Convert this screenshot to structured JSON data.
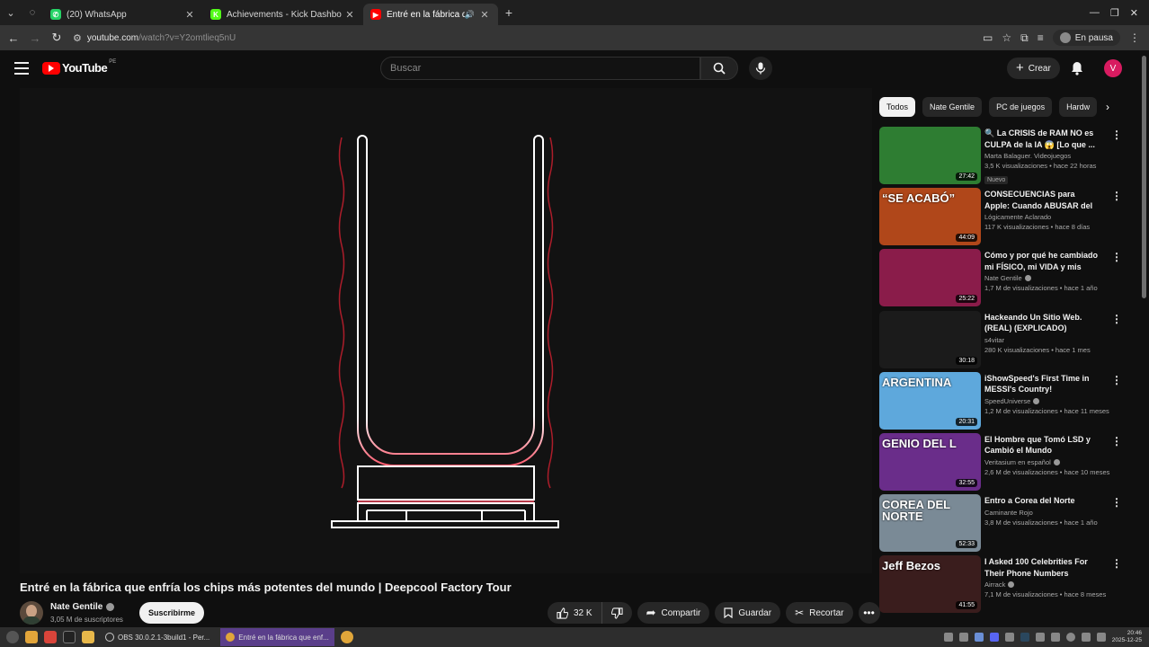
{
  "browser": {
    "tabs": [
      {
        "title": "(20) WhatsApp",
        "fav_color": "#25d366",
        "fav_glyph": "✆"
      },
      {
        "title": "Achievements - Kick Dashbo",
        "fav_color": "#53fc18",
        "fav_glyph": "K"
      },
      {
        "title": "Entré en la fábrica que e",
        "fav_color": "#ff0000",
        "fav_glyph": "▶"
      }
    ],
    "url_site": "youtube.com",
    "url_rest": "/watch?v=Y2omtlieq5nU",
    "profile_status": "En pausa"
  },
  "youtube": {
    "logo_text": "YouTube",
    "logo_country": "PE",
    "search_placeholder": "Buscar",
    "create_label": "Crear",
    "avatar_letter": "V"
  },
  "video": {
    "title": "Entré en la fábrica que enfría los chips más potentes del mundo | Deepcool Factory Tour",
    "channel": "Nate Gentile",
    "subscribers": "3,05 M de suscriptores",
    "subscribe_label": "Suscribirme",
    "likes": "32 K",
    "share_label": "Compartir",
    "save_label": "Guardar",
    "clip_label": "Recortar"
  },
  "chips": [
    "Todos",
    "Nate Gentile",
    "PC de juegos",
    "Hardw"
  ],
  "recommendations": [
    {
      "title": "🔍 La CRISIS de RAM NO es CULPA de la IA 😱 [Lo que ...",
      "channel": "Marta Balaguer. Videojuegos",
      "verified": false,
      "meta": "3,5 K visualizaciones • hace 22 horas",
      "badge": "Nuevo",
      "duration": "27:42",
      "thumb_text": "",
      "thumb_bg": "#2e7d32"
    },
    {
      "title": "CONSECUENCIAS para Apple: Cuando ABUSAR del Usuario ...",
      "channel": "Lógicamente Aclarado",
      "verified": false,
      "meta": "117 K visualizaciones • hace 8 días",
      "badge": "",
      "duration": "44:09",
      "thumb_text": "“SE ACABÓ”",
      "thumb_bg": "#b0471a"
    },
    {
      "title": "Cómo y por qué he cambiado mi FÍSICO, mi VIDA y mis HÁBITOS",
      "channel": "Nate Gentile",
      "verified": true,
      "meta": "1,7 M de visualizaciones • hace 1 año",
      "badge": "",
      "duration": "25:22",
      "thumb_text": "",
      "thumb_bg": "#8a1c4a"
    },
    {
      "title": "Hackeando Un Sitio Web. (REAL) (EXPLICADO)",
      "channel": "s4vitar",
      "verified": false,
      "meta": "280 K visualizaciones • hace 1 mes",
      "badge": "",
      "duration": "30:18",
      "thumb_text": "",
      "thumb_bg": "#1b1b1b"
    },
    {
      "title": "iShowSpeed's First Time in MESSI's Country!",
      "channel": "SpeedUniverse",
      "verified": true,
      "meta": "1,2 M de visualizaciones • hace 11 meses",
      "badge": "",
      "duration": "20:31",
      "thumb_text": "ARGENTINA",
      "thumb_bg": "#5ea8dc"
    },
    {
      "title": "El Hombre que Tomó LSD y Cambió el Mundo",
      "channel": "Veritasium en español",
      "verified": true,
      "meta": "2,6 M de visualizaciones • hace 10 meses",
      "badge": "",
      "duration": "32:55",
      "thumb_text": "GENIO DEL L",
      "thumb_bg": "#6a2d8a"
    },
    {
      "title": "Entro a Corea del Norte",
      "channel": "Caminante Rojo",
      "verified": false,
      "meta": "3,8 M de visualizaciones • hace 1 año",
      "badge": "",
      "duration": "52:33",
      "thumb_text": "COREA DEL NORTE",
      "thumb_bg": "#7a8a96"
    },
    {
      "title": "I Asked 100 Celebrities For Their Phone Numbers",
      "channel": "Airrack",
      "verified": true,
      "meta": "7,1 M de visualizaciones • hace 8 meses",
      "badge": "",
      "duration": "41:55",
      "thumb_text": "Jeff Bezos",
      "thumb_bg": "#3a1d1d"
    }
  ],
  "taskbar": {
    "tasks": [
      "OBS 30.0.2.1-3build1 - Per...",
      "Entré en la fábrica que enf..."
    ],
    "time": "20:46",
    "date": "2025-12-25"
  }
}
